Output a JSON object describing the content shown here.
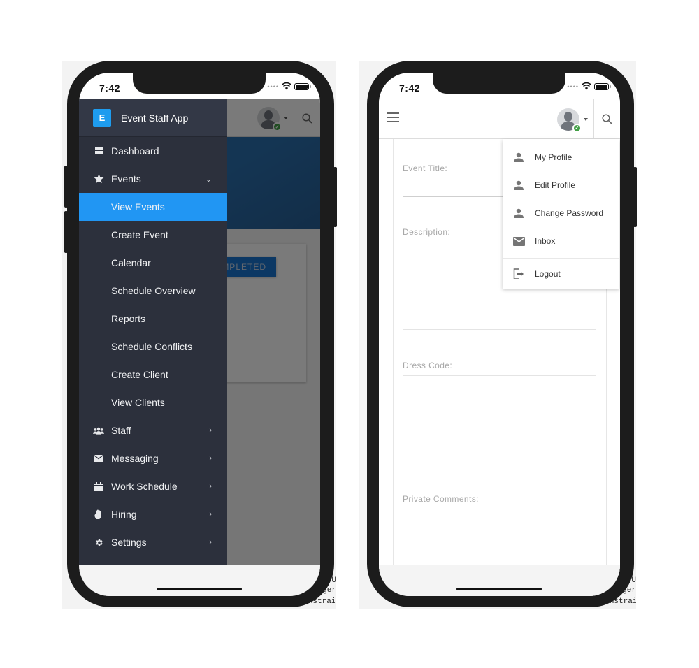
{
  "status_bar": {
    "time": "7:42"
  },
  "left_phone": {
    "drawer": {
      "brand_initial": "E",
      "brand_title": "Event Staff App",
      "items": [
        {
          "label": "Dashboard",
          "icon": "dashboard-icon",
          "type": "top"
        },
        {
          "label": "Events",
          "icon": "star-icon",
          "type": "top",
          "expanded": true,
          "chevron": "⌄"
        },
        {
          "label": "View Events",
          "type": "sub",
          "active": true
        },
        {
          "label": "Create Event",
          "type": "sub"
        },
        {
          "label": "Calendar",
          "type": "sub"
        },
        {
          "label": "Schedule Overview",
          "type": "sub"
        },
        {
          "label": "Reports",
          "type": "sub"
        },
        {
          "label": "Schedule Conflicts",
          "type": "sub"
        },
        {
          "label": "Create Client",
          "type": "sub"
        },
        {
          "label": "View Clients",
          "type": "sub"
        },
        {
          "label": "Staff",
          "icon": "users-icon",
          "type": "top",
          "chevron": "›"
        },
        {
          "label": "Messaging",
          "icon": "envelope-icon",
          "type": "top",
          "chevron": "›"
        },
        {
          "label": "Work Schedule",
          "icon": "calendar-icon",
          "type": "top",
          "chevron": "›"
        },
        {
          "label": "Hiring",
          "icon": "hand-icon",
          "type": "top",
          "chevron": "›"
        },
        {
          "label": "Settings",
          "icon": "gear-icon",
          "type": "top",
          "chevron": "›"
        }
      ]
    },
    "background": {
      "completed_button_label": "MPLETED"
    }
  },
  "right_phone": {
    "form": {
      "event_title_label": "Event Title:",
      "description_label": "Description:",
      "dress_code_label": "Dress Code:",
      "private_comments_label": "Private Comments:"
    },
    "user_menu": {
      "items": [
        {
          "label": "My Profile",
          "icon": "person-icon"
        },
        {
          "label": "Edit Profile",
          "icon": "person-icon"
        },
        {
          "label": "Change Password",
          "icon": "person-icon"
        },
        {
          "label": "Inbox",
          "icon": "envelope-icon"
        }
      ],
      "logout_label": "Logout"
    }
  },
  "colors": {
    "drawer_bg": "#2c303c",
    "active_item": "#2196f3",
    "brand_badge": "#1e9cef",
    "online_badge": "#43a047"
  },
  "backdrop": {
    "log_lines": [
      "t U",
      "gger",
      "The methods in the UIConstrain"
    ]
  }
}
